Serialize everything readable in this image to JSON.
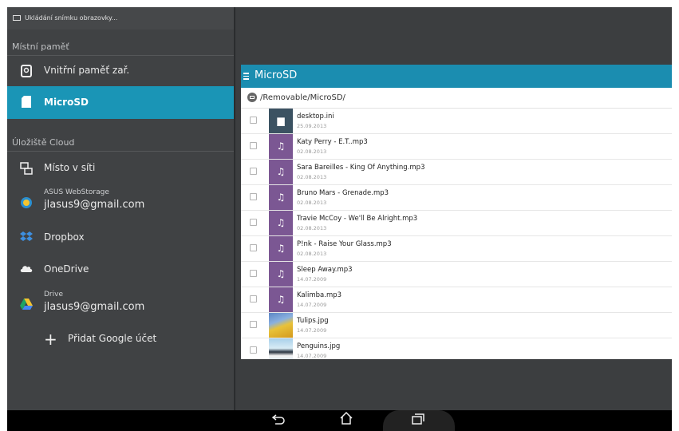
{
  "status": {
    "notification": "Ukládání snímku obrazovky..."
  },
  "drawer": {
    "local_header": "Místní paměť",
    "local_items": [
      {
        "label": "Vnitřní paměť zař.",
        "icon": "phone-storage-icon"
      },
      {
        "label": "MicroSD",
        "icon": "sd-card-icon",
        "selected": true
      }
    ],
    "cloud_header": "Úložiště Cloud",
    "network": {
      "label": "Místo v síti",
      "icon": "network-icon"
    },
    "asus": {
      "service": "ASUS WebStorage",
      "account": "jlasus9@gmail.com",
      "icon": "asus-webstorage-icon"
    },
    "dropbox": {
      "label": "Dropbox",
      "icon": "dropbox-icon"
    },
    "onedrive": {
      "label": "OneDrive",
      "icon": "onedrive-icon"
    },
    "drive": {
      "service": "Drive",
      "account": "jlasus9@gmail.com",
      "icon": "google-drive-icon"
    },
    "add_google": {
      "label": "Přidat Google účet",
      "icon": "plus-icon"
    }
  },
  "panel": {
    "title": "MicroSD",
    "path": "/Removable/MicroSD/",
    "files": [
      {
        "name": "desktop.ini",
        "date": "25.09.2013",
        "type": "doc"
      },
      {
        "name": "Katy Perry - E.T..mp3",
        "date": "02.08.2013",
        "type": "music"
      },
      {
        "name": "Sara Bareilles - King Of Anything.mp3",
        "date": "02.08.2013",
        "type": "music"
      },
      {
        "name": "Bruno Mars - Grenade.mp3",
        "date": "02.08.2013",
        "type": "music"
      },
      {
        "name": "Travie McCoy - We'll Be Alright.mp3",
        "date": "02.08.2013",
        "type": "music"
      },
      {
        "name": "P!nk - Raise Your Glass.mp3",
        "date": "02.08.2013",
        "type": "music"
      },
      {
        "name": "Sleep Away.mp3",
        "date": "14.07.2009",
        "type": "music"
      },
      {
        "name": "Kalimba.mp3",
        "date": "14.07.2009",
        "type": "music"
      },
      {
        "name": "Tulips.jpg",
        "date": "14.07.2009",
        "type": "image"
      },
      {
        "name": "Penguins.jpg",
        "date": "14.07.2009",
        "type": "image"
      }
    ]
  },
  "navbar": {
    "buttons": [
      "back-icon",
      "home-icon",
      "recent-apps-icon"
    ]
  },
  "colors": {
    "accent": "#1a95b6",
    "header": "#1b8db0",
    "drawer": "#404244",
    "music_thumb": "#7b5793",
    "doc_thumb": "#3b5262"
  }
}
